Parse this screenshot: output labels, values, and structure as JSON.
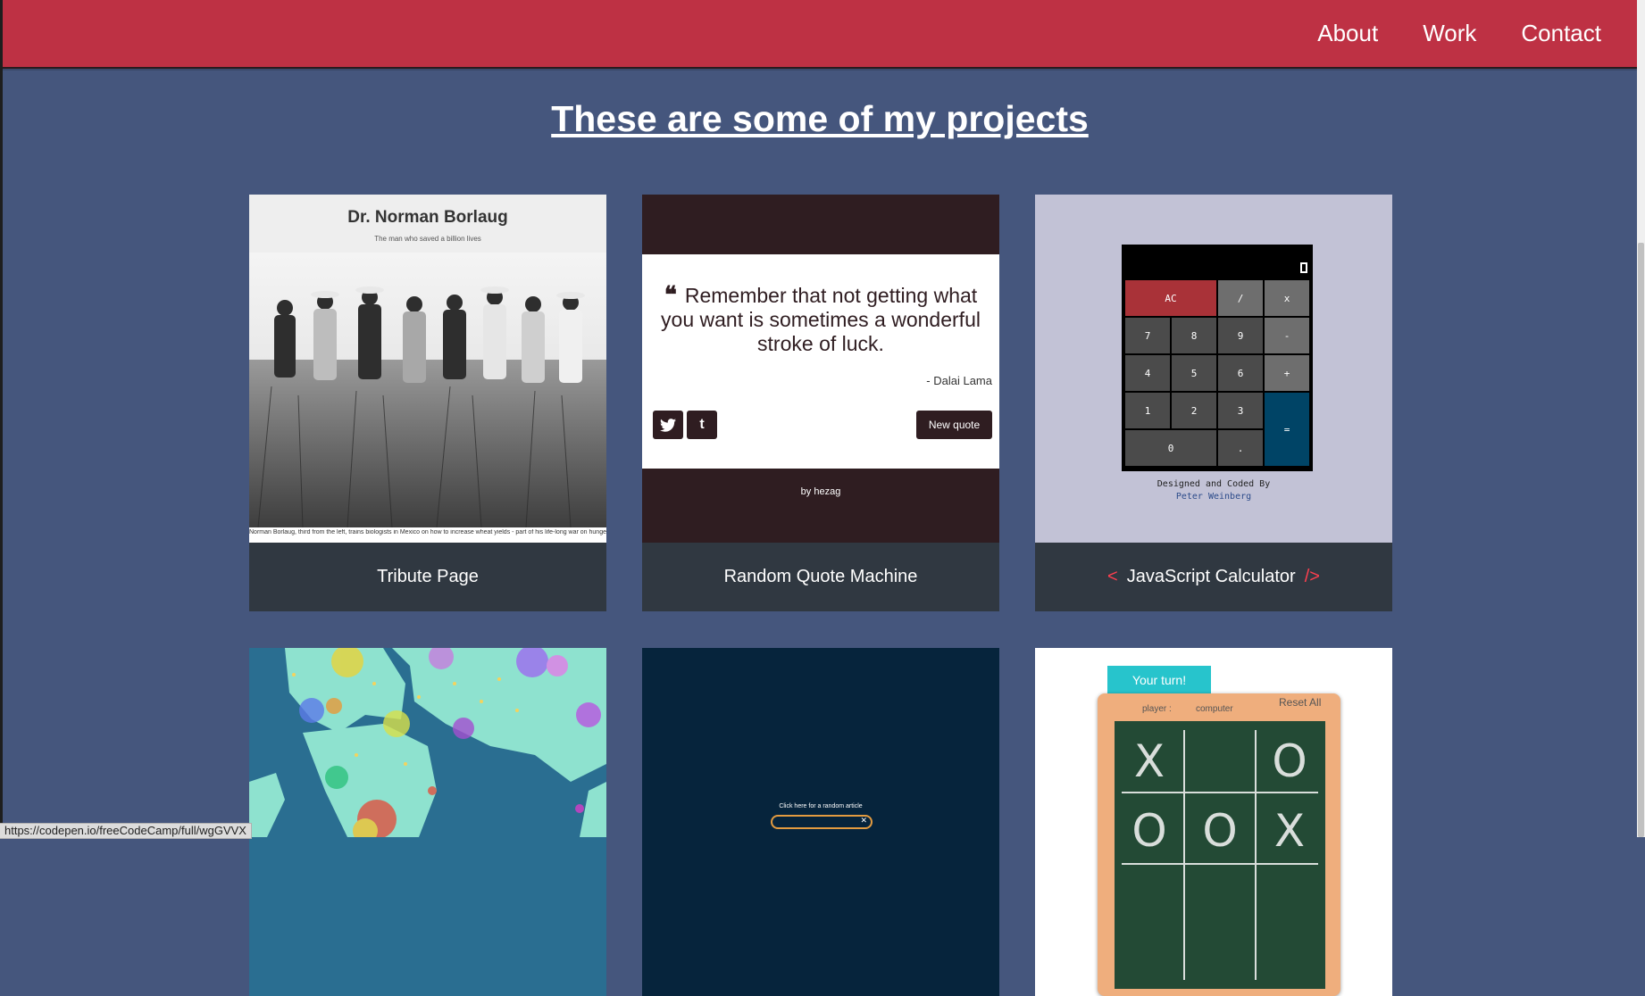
{
  "nav": {
    "links": [
      "About",
      "Work",
      "Contact"
    ]
  },
  "heading": "These are some of my projects",
  "projects": [
    {
      "caption": "Tribute Page",
      "title": "Dr. Norman Borlaug",
      "subtitle": "The man who saved a billion lives",
      "photo_caption": "Norman Borlaug, third from the left, trains biologists in Mexico on how to increase wheat yields - part of his life-long war on hunger."
    },
    {
      "caption": "Random Quote Machine",
      "quote": "Remember that not getting what you want is sometimes a wonderful stroke of luck.",
      "author": "- Dalai Lama",
      "new_quote": "New quote",
      "twitter_icon": "twitter-icon",
      "tumblr_icon": "tumblr-icon",
      "by": "by hezag"
    },
    {
      "caption": "JavaScript Calculator",
      "bracket_left": "<",
      "bracket_right": "/>",
      "credit_line": "Designed and Coded By",
      "credit_author": "Peter Weinberg",
      "keys": [
        "AC",
        "/",
        "x",
        "7",
        "8",
        "9",
        "-",
        "4",
        "5",
        "6",
        "+",
        "1",
        "2",
        "3",
        "=",
        "0",
        "."
      ]
    },
    {
      "caption": ""
    },
    {
      "caption": "",
      "prompt": "Click here for a random article",
      "clear_glyph": "✕"
    },
    {
      "caption": "",
      "turn": "Your turn!",
      "player_label": "player :",
      "computer_label": "computer",
      "reset": "Reset All",
      "cells": [
        "X",
        "",
        "O",
        "O",
        "O",
        "X"
      ]
    }
  ],
  "status_url": "https://codepen.io/freeCodeCamp/full/wgGVVX",
  "colors": {
    "navbar": "#be3144",
    "background": "#45567d",
    "caption_bg": "#303841",
    "accent": "#ff3f4f"
  }
}
